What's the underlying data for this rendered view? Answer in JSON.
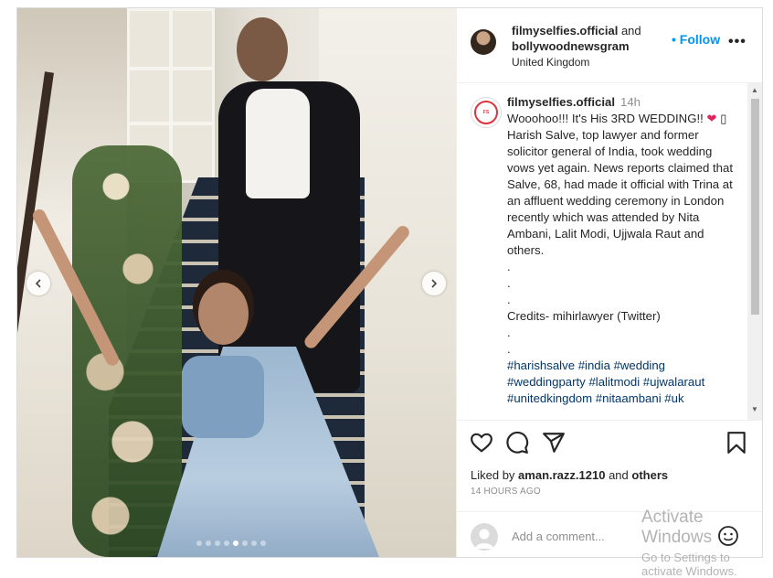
{
  "post": {
    "header": {
      "username": "filmyselfies.official",
      "and_text": "and",
      "coauthor": "bollywoodnewsgram",
      "location": "United Kingdom",
      "follow_label": "• Follow",
      "more_label": "•••"
    },
    "media": {
      "total_slides": 8,
      "active_slide_index": 4
    },
    "caption": {
      "username": "filmyselfies.official",
      "time": "14h",
      "line1": "Wooohoo!!! It's His 3RD WEDDING!!",
      "heart": "❤",
      "line1_tail": "▯",
      "paragraph": "Harish Salve, top lawyer and former solicitor general of India, took wedding vows yet again. News reports claimed that Salve, 68, had made it official with Trina at an affluent wedding ceremony in London recently which was attended by Nita Ambani, Lalit Modi, Ujjwala Raut and others.",
      "dot1": ".",
      "dot2": ".",
      "dot3": ".",
      "credits": "Credits- mihirlawyer (Twitter)",
      "dot4": ".",
      "dot5": ".",
      "hashtags": "#harishsalve #india #wedding #weddingparty #lalitmodi #ujwalaraut #unitedkingdom #nitaambani #uk"
    },
    "likes": {
      "prefix": "Liked by",
      "user": "aman.razz.1210",
      "middle": "and",
      "others": "others"
    },
    "timestamp": "14 HOURS AGO",
    "comment": {
      "placeholder": "Add a comment..."
    }
  },
  "overlay": {
    "activate_line1": "Activate Windows",
    "activate_line2": "Go to Settings to activate Windows."
  }
}
